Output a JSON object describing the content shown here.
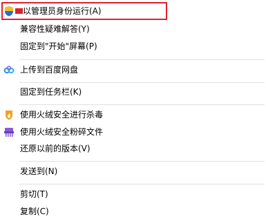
{
  "menu": {
    "items": [
      {
        "label": "以管理员身份运行(A)",
        "icon": "uac-shield-icon"
      },
      {
        "label": "兼容性疑难解答(Y)",
        "icon": ""
      },
      {
        "label": "固定到\"开始\"屏幕(P)",
        "icon": ""
      },
      {
        "label": "上传到百度网盘",
        "icon": "baidu-netdisk-icon"
      },
      {
        "label": "固定到任务栏(K)",
        "icon": ""
      },
      {
        "label": "使用火绒安全进行杀毒",
        "icon": "huorong-flame-icon"
      },
      {
        "label": "使用火绒安全粉碎文件",
        "icon": "huorong-shredder-icon"
      },
      {
        "label": "还原以前的版本(V)",
        "icon": ""
      },
      {
        "label": "发送到(N)",
        "icon": ""
      },
      {
        "label": "剪切(T)",
        "icon": ""
      },
      {
        "label": "复制(C)",
        "icon": ""
      }
    ]
  },
  "colors": {
    "highlight_border": "#e0202a",
    "separator": "#e0e0e0",
    "shield_blue": "#1f6fd6",
    "shield_yellow": "#f5c020",
    "baidu_blue": "#2f8cf0",
    "flame_orange": "#f5a020",
    "shredder_purple": "#8a5cd6"
  }
}
